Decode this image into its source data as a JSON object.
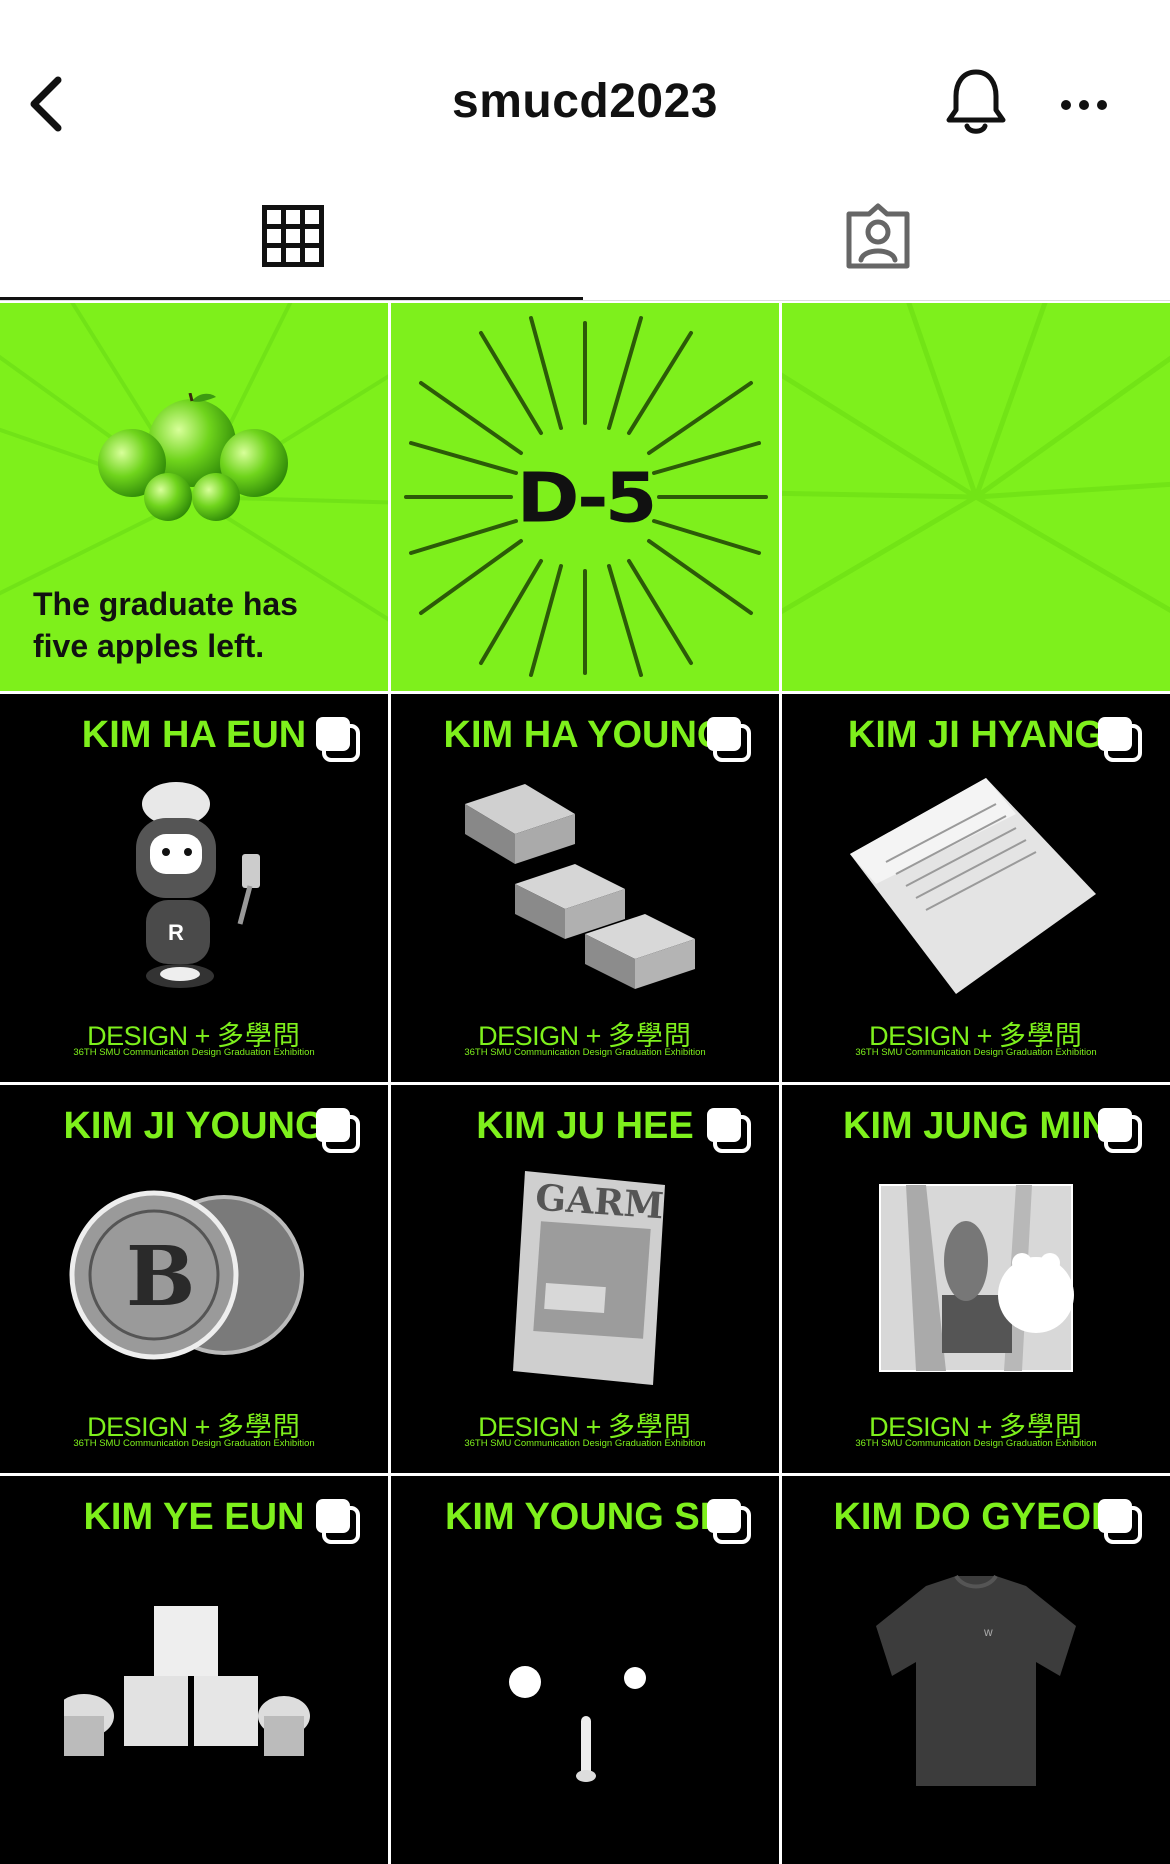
{
  "header": {
    "title": "smucd2023",
    "back_icon": "chevron-left-icon",
    "bell_icon": "bell-icon",
    "more_icon": "more-horizontal-icon"
  },
  "tabs": [
    {
      "name": "grid",
      "icon": "grid-icon",
      "active": true
    },
    {
      "name": "tagged",
      "icon": "tagged-user-icon",
      "active": false
    }
  ],
  "colors": {
    "accent": "#7ef01c",
    "tile_dark": "#000000",
    "text": "#111111"
  },
  "posts": {
    "teaser_apples": {
      "caption_line1": "The graduate has",
      "caption_line2": "five apples left.",
      "image": "green-apples"
    },
    "teaser_countdown": {
      "text": "D-5"
    },
    "teaser_burst": {
      "image": "green-burst"
    },
    "design_label": "DESIGN",
    "design_plus": "+",
    "design_hanja": "多學問",
    "exhibition": "36TH SMU Communication Design Graduation Exhibition",
    "students": [
      {
        "name": "KIM HA EUN",
        "image": "chef-robot"
      },
      {
        "name": "KIM HA YOUNG",
        "image": "modular-device"
      },
      {
        "name": "KIM JI HYANG",
        "image": "paper-form"
      },
      {
        "name": "KIM JI YOUNG",
        "image": "bitcoin-coins"
      },
      {
        "name": "KIM JU HEE",
        "image": "garm-magazine"
      },
      {
        "name": "KIM JUNG MIN",
        "image": "illustration-bear"
      },
      {
        "name": "KIM YE EUN",
        "image": "cupcake-boxes"
      },
      {
        "name": "KIM YOUNG SE",
        "image": "night-bird"
      },
      {
        "name": "KIM DO GYEON",
        "image": "t-shirt"
      }
    ]
  }
}
